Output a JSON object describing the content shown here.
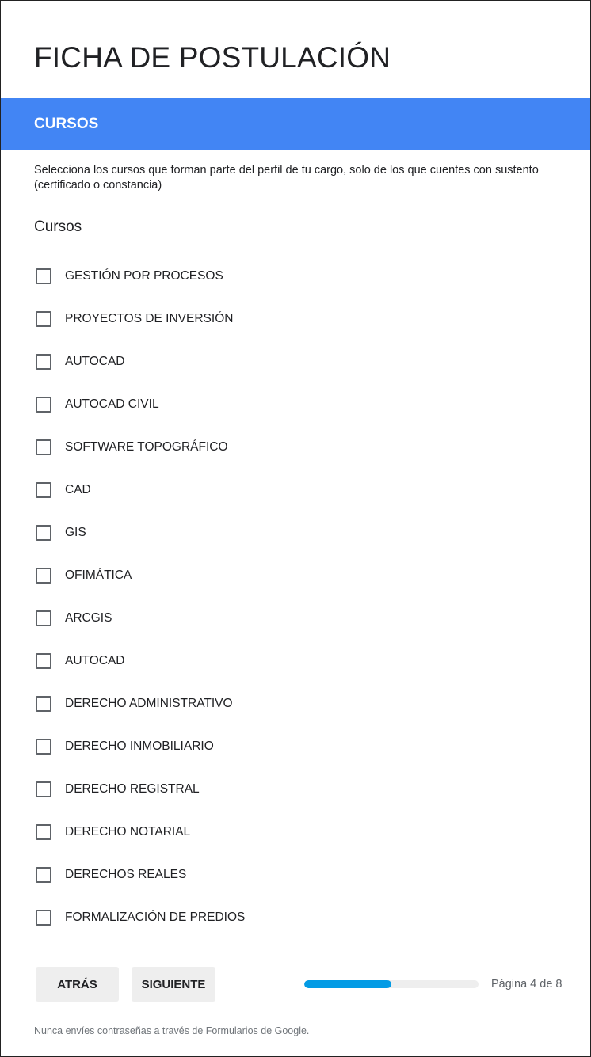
{
  "form": {
    "title": "FICHA DE POSTULACIÓN"
  },
  "section": {
    "title": "CURSOS",
    "description": "Selecciona los cursos que forman parte del perfil de tu cargo, solo de los que cuentes con sustento (certificado o constancia)",
    "accent_color": "#4285f4"
  },
  "question": {
    "title": "Cursos",
    "options": [
      {
        "label": "GESTIÓN POR PROCESOS",
        "checked": false
      },
      {
        "label": "PROYECTOS DE INVERSIÓN",
        "checked": false
      },
      {
        "label": "AUTOCAD",
        "checked": false
      },
      {
        "label": "AUTOCAD CIVIL",
        "checked": false
      },
      {
        "label": "SOFTWARE TOPOGRÁFICO",
        "checked": false
      },
      {
        "label": "CAD",
        "checked": false
      },
      {
        "label": "GIS",
        "checked": false
      },
      {
        "label": "OFIMÁTICA",
        "checked": false
      },
      {
        "label": "ARCGIS",
        "checked": false
      },
      {
        "label": "AUTOCAD",
        "checked": false
      },
      {
        "label": "DERECHO ADMINISTRATIVO",
        "checked": false
      },
      {
        "label": "DERECHO INMOBILIARIO",
        "checked": false
      },
      {
        "label": "DERECHO REGISTRAL",
        "checked": false
      },
      {
        "label": "DERECHO NOTARIAL",
        "checked": false
      },
      {
        "label": "DERECHOS REALES",
        "checked": false
      },
      {
        "label": "FORMALIZACIÓN DE PREDIOS",
        "checked": false
      }
    ]
  },
  "navigation": {
    "back_label": "ATRÁS",
    "next_label": "SIGUIENTE",
    "page_indicator": "Página 4 de 8",
    "current_page": 4,
    "total_pages": 8,
    "progress_color": "#039be5"
  },
  "footer": {
    "note": "Nunca envíes contraseñas a través de Formularios de Google."
  }
}
